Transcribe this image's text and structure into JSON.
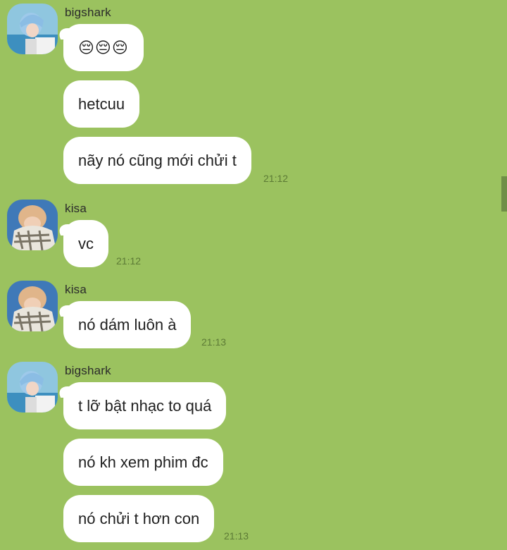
{
  "users": {
    "bigshark": "bigshark",
    "kisa": "kisa"
  },
  "messages": {
    "m1": "😔😔😔",
    "m2": "hetcuu",
    "m3": "nãy nó cũng mới chửi t",
    "m4": "vc",
    "m5": "nó dám luôn à",
    "m6": "t lỡ bật nhạc to quá",
    "m7": "nó kh xem phim đc",
    "m8": "nó chửi t hơn con"
  },
  "times": {
    "t1": "21:12",
    "t2": "21:12",
    "t3": "21:13",
    "t4": "21:13"
  },
  "colors": {
    "background": "#9bc25f",
    "bubble": "#ffffff",
    "timestamp": "#5c7a35"
  }
}
